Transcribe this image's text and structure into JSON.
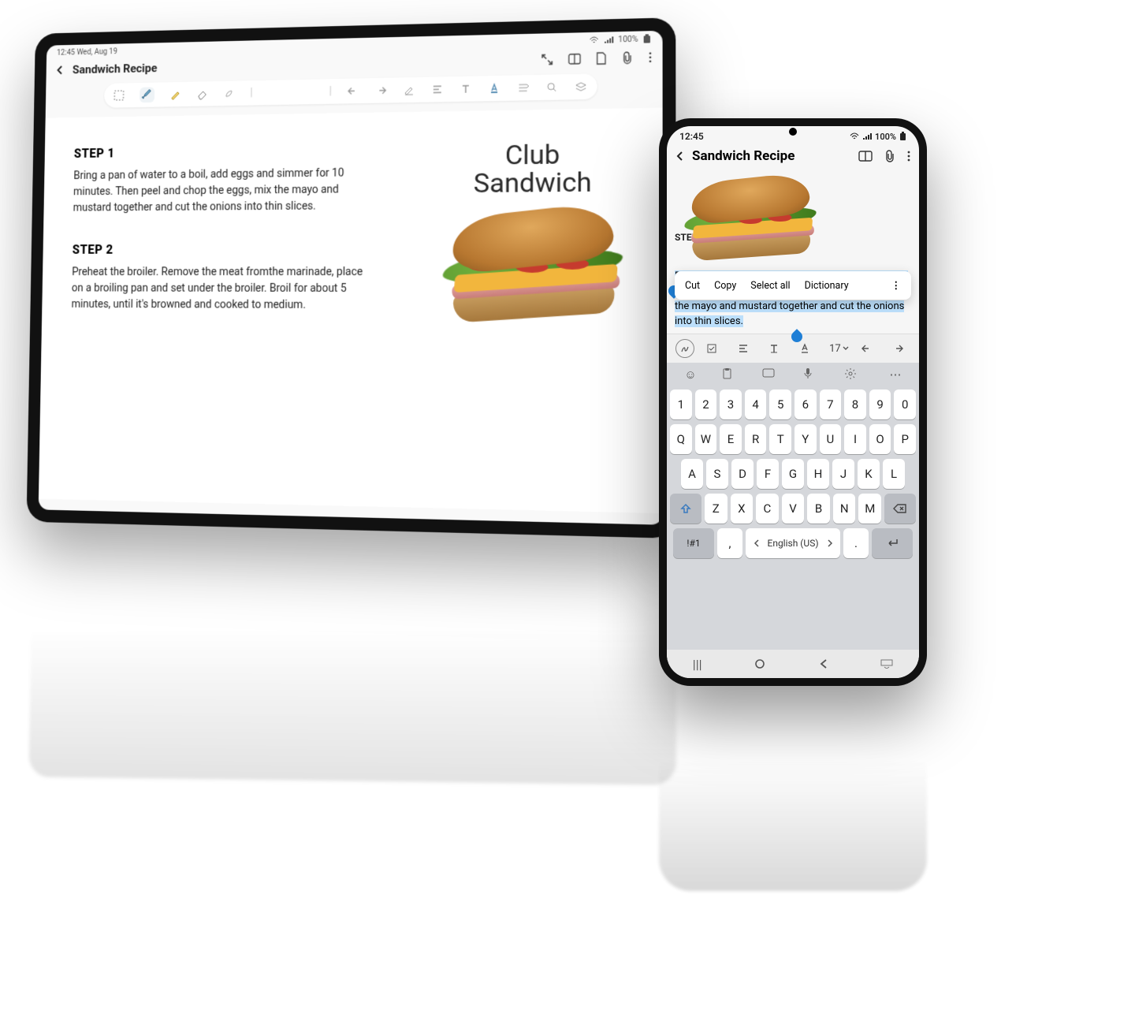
{
  "tablet": {
    "status": {
      "time": "12:45",
      "date": "Wed, Aug 19",
      "battery": "100%"
    },
    "title": "Sandwich Recipe",
    "toolbar_colors": [
      "#e79b94",
      "#8fb7b3",
      "#1f3a4c"
    ],
    "sandwich_label_line1": "Club",
    "sandwich_label_line2": "Sandwich",
    "steps": [
      {
        "title": "STEP 1",
        "body": "Bring a pan of water to a boil, add eggs and simmer for 10 minutes. Then peel and chop the eggs, mix the mayo and mustard together and cut the onions into thin slices."
      },
      {
        "title": "STEP 2",
        "body": "Preheat the broiler. Remove the meat fromthe marinade, place on a broiling pan and set under the broiler. Broil for about 5 minutes, until it's browned and cooked to medium."
      }
    ]
  },
  "phone": {
    "status": {
      "time": "12:45",
      "battery": "100%"
    },
    "title": "Sandwich Recipe",
    "step_label": "STEP 1",
    "context_menu": [
      "Cut",
      "Copy",
      "Select all",
      "Dictionary"
    ],
    "selected_text": "Bring a pan of water to a boil, add eggs and simmer for 10 minutes. Then peel and chop the eggs, mix the mayo and mustard together and cut the onions into thin slices.",
    "format_bar": {
      "font_size": "17"
    },
    "keyboard": {
      "row_num": [
        "1",
        "2",
        "3",
        "4",
        "5",
        "6",
        "7",
        "8",
        "9",
        "0"
      ],
      "row1": [
        "Q",
        "W",
        "E",
        "R",
        "T",
        "Y",
        "U",
        "I",
        "O",
        "P"
      ],
      "row2": [
        "A",
        "S",
        "D",
        "F",
        "G",
        "H",
        "J",
        "K",
        "L"
      ],
      "row3": [
        "Z",
        "X",
        "C",
        "V",
        "B",
        "N",
        "M"
      ],
      "symbol_key": "!#1",
      "comma": ",",
      "period": ".",
      "language": "English (US)"
    }
  }
}
